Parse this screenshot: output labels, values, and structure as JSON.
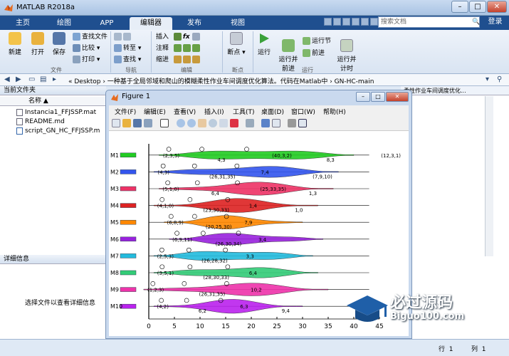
{
  "window": {
    "title": "MATLAB R2018a",
    "minimize": "–",
    "maximize": "□",
    "close": "✕"
  },
  "tabs": [
    "主页",
    "绘图",
    "APP",
    "编辑器",
    "发布",
    "视图"
  ],
  "active_tab": "编辑器",
  "search": {
    "placeholder": "搜索文档",
    "login": "登录"
  },
  "toolstrip": {
    "file": {
      "new": "新建",
      "open": "打开",
      "save": "保存",
      "find_files": "查找文件",
      "compare": "比较 ▾",
      "print": "打印 ▾",
      "label": "文件"
    },
    "nav": {
      "goto": "转至 ▾",
      "find": "查找 ▾",
      "label": "导航"
    },
    "edit": {
      "insert": "插入",
      "comment": "注释",
      "indent": "缩进",
      "fx": "fx",
      "label": "编辑"
    },
    "breakpoints": {
      "bp": "断点",
      "label": "断点"
    },
    "run": {
      "run": "运行",
      "run_advance": "运行并\n前进",
      "run_section": "运行节",
      "advance": "前进",
      "run_time": "运行并\n计时",
      "label": "运行"
    }
  },
  "address": {
    "path": "« Desktop › 一种基于全局邻域和爬山的模糊柔性作业车间调度优化算法。代码在Matlab中 › GN-HC-main"
  },
  "current_folder": {
    "title": "当前文件夹",
    "column": "名称 ▲",
    "files": [
      "Instancia1_FFJSSP.mat",
      "README.md",
      "script_GN_HC_FFJSSP.m"
    ],
    "details_title": "详细信息",
    "details_hint": "选择文件以查看详细信息"
  },
  "right_panel": {
    "header": "柔性作业车间调度优化..."
  },
  "status": {
    "row_label": "行",
    "row": "1",
    "col_label": "列",
    "col": "1"
  },
  "figure": {
    "title": "Figure 1",
    "menu": [
      "文件(F)",
      "编辑(E)",
      "查看(V)",
      "插入(I)",
      "工具(T)",
      "桌面(D)",
      "窗口(W)",
      "帮助(H)"
    ]
  },
  "chart_data": {
    "type": "violin",
    "title": "",
    "xlabel": "",
    "ylabel": "",
    "xlim": [
      0,
      45
    ],
    "xticks": [
      0,
      5,
      10,
      15,
      20,
      25,
      30,
      35,
      40,
      45
    ],
    "categories": [
      "M1",
      "M2",
      "M3",
      "M4",
      "M5",
      "M6",
      "M7",
      "M8",
      "M9",
      "M10"
    ],
    "series": [
      {
        "name": "M1",
        "color": "#22cc22",
        "range": [
          2,
          40
        ],
        "labels": [
          "(2,3,5)",
          "4,3",
          "(40,3,2)",
          "8,3",
          "(12,3,1)"
        ]
      },
      {
        "name": "M2",
        "color": "#3355ee",
        "range": [
          1,
          37
        ],
        "labels": [
          "(4,3)",
          "(26,31,35)",
          "7,4",
          "(7,9,10)"
        ]
      },
      {
        "name": "M3",
        "color": "#ee3366",
        "range": [
          2,
          36
        ],
        "labels": [
          "(5,1,0)",
          "6,4",
          "(25,33,35)",
          "1,3"
        ]
      },
      {
        "name": "M4",
        "color": "#dd2222",
        "range": [
          1,
          33
        ],
        "labels": [
          "(4,1,0)",
          "(23,30,33)",
          "1,4",
          "1,0"
        ]
      },
      {
        "name": "M5",
        "color": "#ff8800",
        "range": [
          3,
          30
        ],
        "labels": [
          "(6,8,9)",
          "(20,25,30)",
          "7,9"
        ]
      },
      {
        "name": "M6",
        "color": "#9922dd",
        "range": [
          4,
          34
        ],
        "labels": [
          "(6,9,11)",
          "(26,30,34)",
          "3,4"
        ]
      },
      {
        "name": "M7",
        "color": "#22bbdd",
        "range": [
          1,
          32
        ],
        "labels": [
          "(2,5,3)",
          "(26,28,32)",
          "3,3"
        ]
      },
      {
        "name": "M8",
        "color": "#33cc77",
        "range": [
          1,
          33
        ],
        "labels": [
          "(3,5,1)",
          "(28,30,33)",
          "6,4"
        ]
      },
      {
        "name": "M9",
        "color": "#ee33aa",
        "range": [
          -1,
          35
        ],
        "labels": [
          "(1,2,3)",
          "(26,31,35)",
          "10,2"
        ]
      },
      {
        "name": "M10",
        "color": "#bb22ee",
        "range": [
          1,
          30
        ],
        "labels": [
          "(4,2)",
          "6,2",
          "6,3",
          "9,4"
        ]
      }
    ],
    "grid": false
  },
  "watermark": {
    "text": "必过源码",
    "sub": "Biguo100.com"
  }
}
